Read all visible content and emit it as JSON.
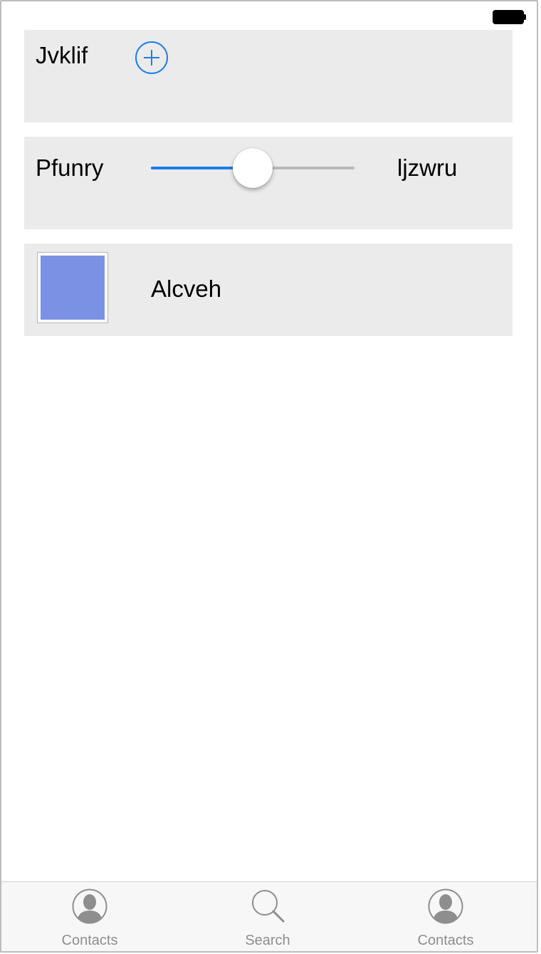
{
  "status_bar": {
    "battery_icon": "battery-icon"
  },
  "cards": {
    "card1": {
      "label": "Jvklif",
      "add_icon": "plus-circle-icon"
    },
    "card2": {
      "label_left": "Pfunry",
      "label_right": "ljzwru",
      "slider_value": 0.5
    },
    "card3": {
      "swatch_color": "#7b91e3",
      "label": "Alcveh"
    }
  },
  "tabbar": {
    "tabs": [
      {
        "label": "Contacts",
        "icon": "contact-icon"
      },
      {
        "label": "Search",
        "icon": "search-icon"
      },
      {
        "label": "Contacts",
        "icon": "contact-icon"
      }
    ]
  },
  "colors": {
    "accent": "#1a7ee8",
    "card_bg": "#ebebeb",
    "tab_icon": "#8e8e8e"
  }
}
